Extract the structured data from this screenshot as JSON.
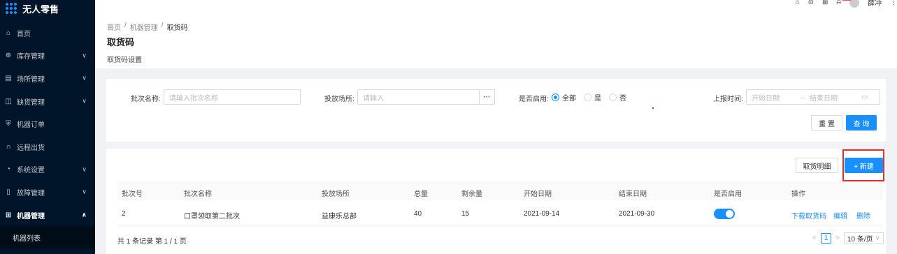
{
  "app": {
    "title": "无人零售"
  },
  "colors": {
    "primary": "#1890ff",
    "sidebar_bg": "#001529",
    "highlight": "#e52b2b"
  },
  "header": {
    "user": "薛冲",
    "icons": [
      "home-icon",
      "help-icon",
      "grid-icon",
      "bell-icon"
    ]
  },
  "sidebar": {
    "items": [
      {
        "label": "首页",
        "icon": "home-icon",
        "has_children": false
      },
      {
        "label": "库存管理",
        "icon": "stock-icon",
        "has_children": true
      },
      {
        "label": "场所管理",
        "icon": "place-icon",
        "has_children": true
      },
      {
        "label": "缺货管理",
        "icon": "shortage-icon",
        "has_children": true
      },
      {
        "label": "机器订单",
        "icon": "order-icon",
        "has_children": false
      },
      {
        "label": "远程出货",
        "icon": "remote-icon",
        "has_children": false
      },
      {
        "label": "系统设置",
        "icon": "settings-icon",
        "has_children": true
      },
      {
        "label": "故障管理",
        "icon": "fault-icon",
        "has_children": true
      },
      {
        "label": "机器管理",
        "icon": "machine-icon",
        "has_children": true,
        "active": true
      }
    ],
    "sub_item": "机器列表"
  },
  "breadcrumb": [
    "首页",
    "机器管理",
    "取货码"
  ],
  "page": {
    "title": "取货码",
    "subtitle": "取货码设置"
  },
  "filter": {
    "batch_name_label": "批次名称:",
    "batch_name_placeholder": "请输入批次名称",
    "place_label": "投放场所:",
    "place_placeholder": "请输入",
    "place_more": "···",
    "enabled_label": "是否启用:",
    "enabled_options": [
      "全部",
      "是",
      "否"
    ],
    "enabled_selected": "全部",
    "report_time_label": "上报时间:",
    "start_placeholder": "开始日期",
    "range_sep": "→",
    "end_placeholder": "结束日期",
    "reset": "重 置",
    "query": "查 询"
  },
  "toolbar": {
    "detail": "取货明细",
    "new": "+ 新建"
  },
  "table": {
    "columns": [
      "批次号",
      "批次名称",
      "投放场所",
      "总量",
      "剩余量",
      "开始日期",
      "结束日期",
      "是否启用",
      "操作"
    ],
    "rows": [
      {
        "batch_no": "2",
        "name": "口罩领取第二批次",
        "place": "益康乐总部",
        "total": "40",
        "remaining": "15",
        "start": "2021-09-14",
        "end": "2021-09-30",
        "enabled": true,
        "actions": [
          "下载取货码",
          "编辑",
          "删除"
        ]
      }
    ]
  },
  "pagination": {
    "summary": "共 1 条记录 第 1 / 1 页",
    "current": "1",
    "prev": "<",
    "next": ">",
    "page_size": "10 条/页",
    "page_size_chevron": "∨"
  }
}
